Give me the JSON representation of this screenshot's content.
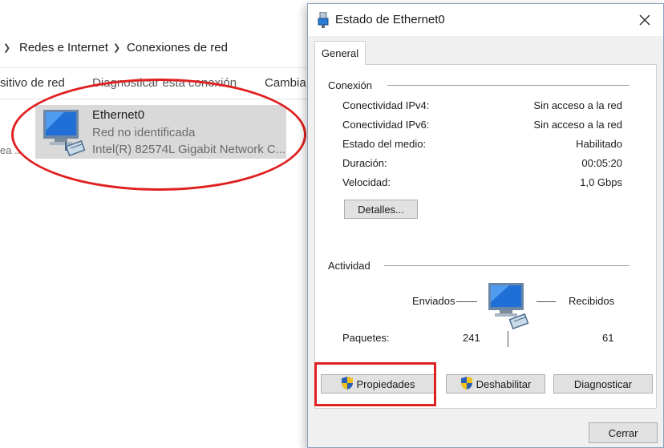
{
  "explorer": {
    "breadcrumb": [
      "Redes e Internet",
      "Conexiones de red"
    ],
    "toolbar": [
      "sitivo de red",
      "Diagnosticar esta conexión",
      "Cambia"
    ],
    "left_cut_text": "ea ...",
    "adapter": {
      "name": "Ethernet0",
      "status": "Red no identificada",
      "device": "Intel(R) 82574L Gigabit Network C..."
    }
  },
  "dialog": {
    "title": "Estado de Ethernet0",
    "tab": "General",
    "connection": {
      "label": "Conexión",
      "rows": [
        {
          "label": "Conectividad IPv4:",
          "value": "Sin acceso a la red"
        },
        {
          "label": "Conectividad IPv6:",
          "value": "Sin acceso a la red"
        },
        {
          "label": "Estado del medio:",
          "value": "Habilitado"
        },
        {
          "label": "Duración:",
          "value": "00:05:20"
        },
        {
          "label": "Velocidad:",
          "value": "1,0 Gbps"
        }
      ],
      "details_button": "Detalles..."
    },
    "activity": {
      "label": "Actividad",
      "sent_label": "Enviados",
      "received_label": "Recibidos",
      "packets_label": "Paquetes:",
      "packets_sent": "241",
      "packets_received": "61"
    },
    "buttons": {
      "properties": "Propiedades",
      "disable": "Deshabilitar",
      "diagnose": "Diagnosticar",
      "close": "Cerrar"
    }
  },
  "colors": {
    "annotation": "#e02020",
    "dialog_bg": "#f0f0f0",
    "adapter_selected": "#d9d9d9"
  },
  "icons": [
    "network-adapter-icon",
    "ethernet-title-icon",
    "close-icon",
    "uac-shield-icon"
  ]
}
